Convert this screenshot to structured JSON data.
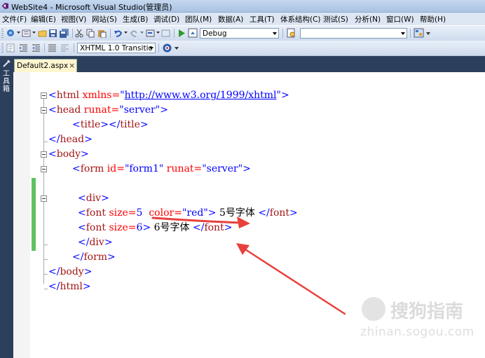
{
  "window": {
    "title": "WebSite4 - Microsoft Visual Studio(管理员)"
  },
  "menu": [
    "文件(F)",
    "编辑(E)",
    "视图(V)",
    "网站(S)",
    "生成(B)",
    "调试(D)",
    "团队(M)",
    "数据(A)",
    "工具(T)",
    "体系结构(C)",
    "测试(S)",
    "分析(N)",
    "窗口(W)",
    "帮助(H)"
  ],
  "toolbar": {
    "config_value": "Debug",
    "find_value": "",
    "schema_value": "XHTML 1.0 Transitic"
  },
  "toolbox_label": "工具箱",
  "tab": {
    "label": "Default2.aspx",
    "close": "×"
  },
  "code": {
    "l1": {
      "open": "<",
      "tag": "html",
      "attr": " xmlns=",
      "val_q1": "\"",
      "url": "http://www.w3.org/1999/xhtml",
      "val_q2": "\"",
      "close": ">"
    },
    "l2": {
      "open": "<",
      "tag": "head",
      "attr": " runat=",
      "val": "\"server\"",
      "close": ">"
    },
    "l3": {
      "open": "<",
      "tag": "title",
      "close": ">",
      "open2": "</",
      "tag2": "title",
      "close2": ">"
    },
    "l4": {
      "open": "</",
      "tag": "head",
      "close": ">"
    },
    "l5": {
      "open": "<",
      "tag": "body",
      "close": ">"
    },
    "l6": {
      "open": "<",
      "tag": "form",
      "attr1": " id=",
      "val1": "\"form1\"",
      "attr2": " runat=",
      "val2": "\"server\"",
      "close": ">"
    },
    "l8": {
      "open": "<",
      "tag": "div",
      "close": ">"
    },
    "l9": {
      "open": "<",
      "tag": "font",
      "attr1": " size=",
      "val1": "5",
      "attr2": "  color=",
      "val2": "\"red\"",
      "close": ">",
      "text": " 5号字体 ",
      "open2": "</",
      "tag2": "font",
      "close2": ">"
    },
    "l10": {
      "open": "<",
      "tag": "font",
      "attr1": " size=",
      "val1": "6",
      "close": ">",
      "text": " 6号字体 ",
      "open2": "</",
      "tag2": "font",
      "close2": ">"
    },
    "l11": {
      "open": "</",
      "tag": "div",
      "close": ">"
    },
    "l12": {
      "open": "</",
      "tag": "form",
      "close": ">"
    },
    "l13": {
      "open": "</",
      "tag": "body",
      "close": ">"
    },
    "l14": {
      "open": "</",
      "tag": "html",
      "close": ">"
    }
  },
  "watermark": {
    "cn": "搜狗指南",
    "en": "zhinan.sogou.com"
  },
  "colors": {
    "annotation_arrow": "#e8413c",
    "change_bar": "#5ec25e",
    "tab_background": "#fff6d0"
  }
}
